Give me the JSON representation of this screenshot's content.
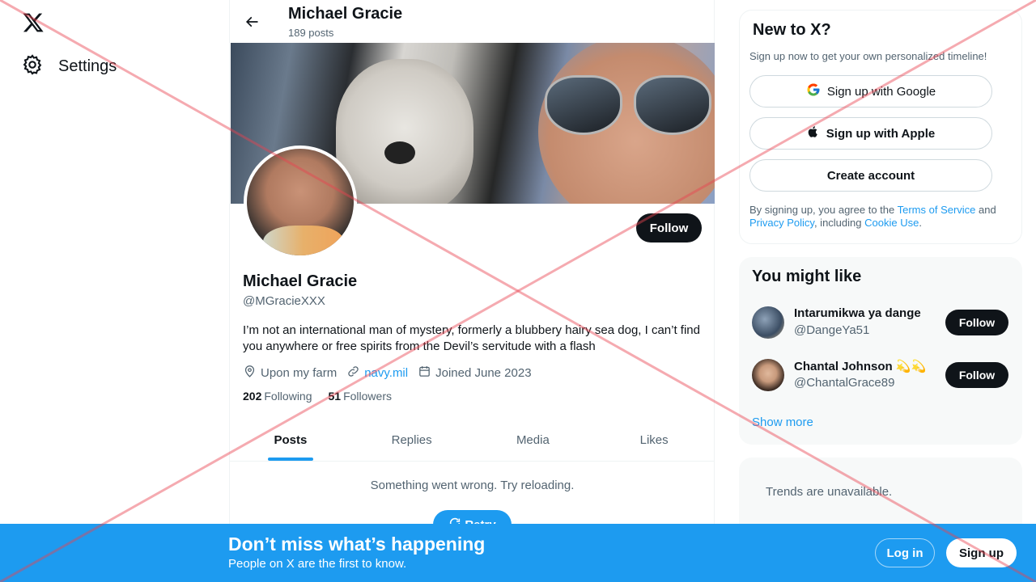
{
  "nav": {
    "settings_label": "Settings",
    "logo_icon": "x-logo-icon",
    "settings_icon": "gear-icon"
  },
  "header": {
    "name": "Michael Gracie",
    "post_count": "189 posts"
  },
  "profile": {
    "name": "Michael Gracie",
    "handle": "@MGracieXXX",
    "bio": "I’m not an international man of mystery, formerly a blubbery hairy sea dog, I can’t find you anywhere or free spirits from the Devil’s servitude with a flash",
    "location": "Upon my farm",
    "website": "navy.mil",
    "joined": "Joined June 2023",
    "following_count": "202",
    "following_label": "Following",
    "followers_count": "51",
    "followers_label": "Followers",
    "follow_label": "Follow"
  },
  "tabs": [
    {
      "label": "Posts",
      "active": true
    },
    {
      "label": "Replies",
      "active": false
    },
    {
      "label": "Media",
      "active": false
    },
    {
      "label": "Likes",
      "active": false
    }
  ],
  "feed": {
    "error_message": "Something went wrong. Try reloading.",
    "retry_label": "Retry"
  },
  "signup_card": {
    "title": "New to X?",
    "subtitle": "Sign up now to get your own personalized timeline!",
    "google_label": "Sign up with Google",
    "apple_label": "Sign up with Apple",
    "create_label": "Create account",
    "terms_prefix": "By signing up, you agree to the ",
    "terms_link": "Terms of Service",
    "terms_and": " and ",
    "privacy_link": "Privacy Policy",
    "terms_including": ", including ",
    "cookie_link": "Cookie Use",
    "terms_end": "."
  },
  "you_might_like": {
    "title": "You might like",
    "users": [
      {
        "name": "Intarumikwa ya dange",
        "handle": "@DangeYa51",
        "follow_label": "Follow",
        "emoji": ""
      },
      {
        "name": "Chantal Johnson",
        "handle": "@ChantalGrace89",
        "follow_label": "Follow",
        "emoji": "💫💫"
      }
    ],
    "show_more": "Show more"
  },
  "trends": {
    "message": "Trends are unavailable."
  },
  "bottom_bar": {
    "title": "Don’t miss what’s happening",
    "subtitle": "People on X are the first to know.",
    "login_label": "Log in",
    "signup_label": "Sign up"
  },
  "colors": {
    "accent": "#1d9bf0",
    "text_primary": "#0f1419",
    "text_secondary": "#536471",
    "watermark": "#e8434f"
  }
}
